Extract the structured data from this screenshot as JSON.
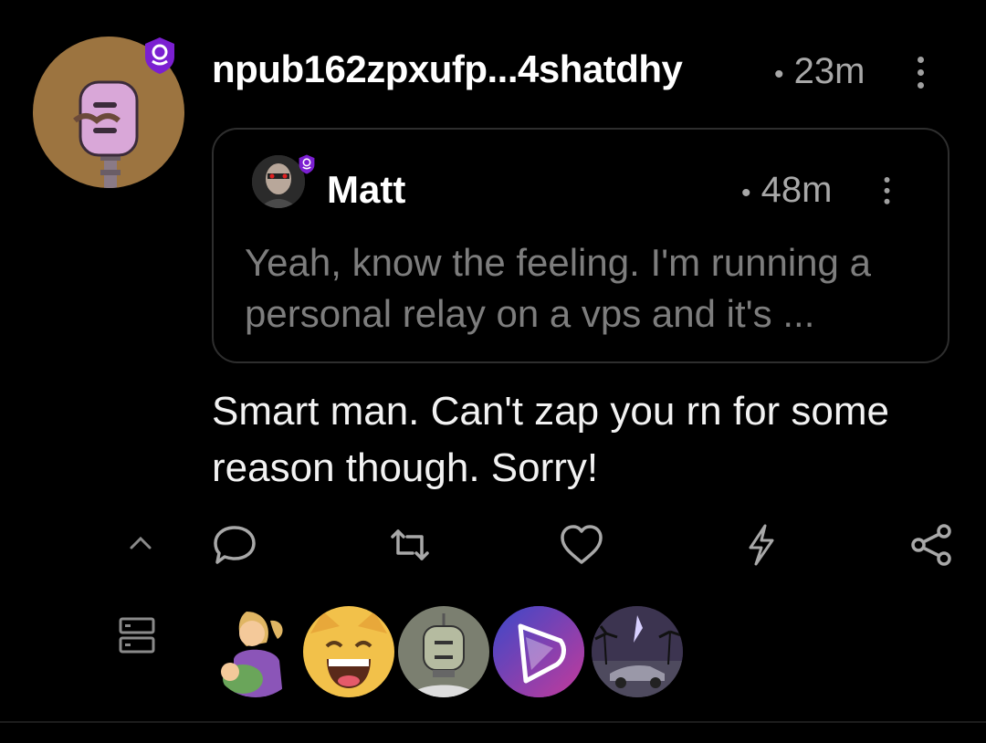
{
  "note": {
    "author": "npub162zpxufp...4shatdhy",
    "time_separator": "•",
    "time": "23m",
    "body": "Smart man. Can't zap you rn for some reason though. Sorry!"
  },
  "quoted": {
    "author": "Matt",
    "time_separator": "•",
    "time": "48m",
    "text": "Yeah, know the feeling. I'm running a personal relay on a vps and it's ..."
  },
  "actions": [
    "collapse-chevron-icon",
    "reply-icon",
    "repost-icon",
    "like-icon",
    "zap-icon",
    "share-icon"
  ],
  "relays_icon": "relay-list-icon",
  "reactors": [
    "woman-feeding-baby-avatar",
    "laughing-cat-avatar",
    "robot-avatar",
    "purple-logo-avatar",
    "palm-tree-car-avatar"
  ],
  "colors": {
    "background": "#000000",
    "badge": "#7b1fd1",
    "muted": "#a8a8a8",
    "quote_text": "#7d7d7d"
  }
}
